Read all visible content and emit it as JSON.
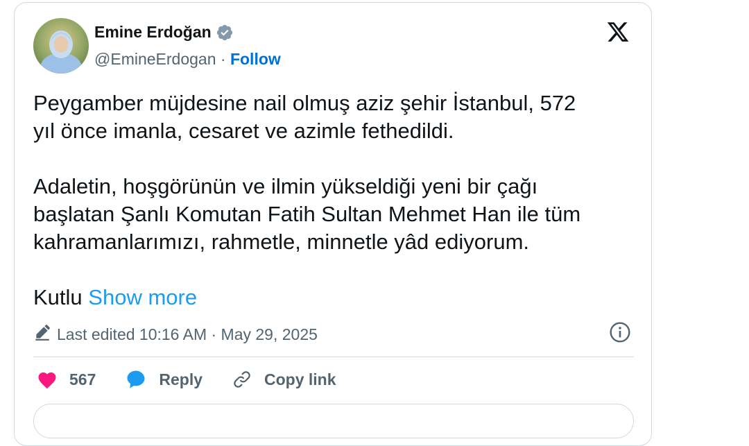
{
  "author": {
    "name": "Emine Erdoğan",
    "handle": "@EmineErdogan",
    "separator": " · ",
    "follow_label": "Follow"
  },
  "icons": {
    "verified": "verified-badge-icon",
    "logo": "x-logo-icon",
    "edit": "pencil-icon",
    "info": "info-icon",
    "like": "heart-icon",
    "reply": "speech-bubble-icon",
    "copy": "link-icon"
  },
  "colors": {
    "follow": "#006fd6",
    "show_more": "#1d9bf0",
    "like": "#f91880",
    "reply": "#1d9bf0",
    "muted": "#536471"
  },
  "tweet": {
    "paragraph1_line1": "Peygamber müjdesine nail olmuş aziz şehir İstanbul, 572",
    "paragraph1_line2": "yıl önce imanla, cesaret ve azimle fethedildi.",
    "paragraph2_line1": "Adaletin, hoşgörünün ve ilmin yükseldiği yeni bir çağı",
    "paragraph2_line2": "başlatan Şanlı Komutan Fatih Sultan Mehmet Han ile tüm",
    "paragraph2_line3": "kahramanlarımızı, rahmetle, minnetle yâd ediyorum.",
    "paragraph3_start": "Kutlu",
    "show_more_label": "Show more"
  },
  "meta": {
    "edited_text": "Last edited 10:16 AM · May 29, 2025"
  },
  "actions": {
    "like_count": "567",
    "reply_label": "Reply",
    "copy_link_label": "Copy link"
  }
}
